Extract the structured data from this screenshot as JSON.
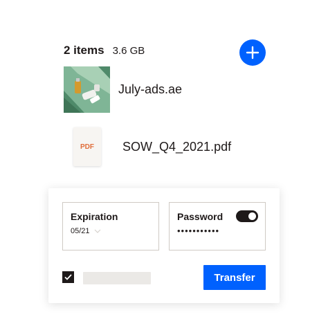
{
  "summary": {
    "count": "2 items",
    "size": "3.6 GB"
  },
  "colors": {
    "accent": "#0061fe",
    "dark": "#1e1919",
    "pdf_label": "#e06d3a"
  },
  "icons": {
    "add": "plus-icon",
    "check": "checkmark-icon",
    "chevron": "chevron-down-icon"
  },
  "files": [
    {
      "name": "July-ads.ae",
      "thumbnail": "image-thumbnail"
    },
    {
      "name": "SOW_Q4_2021.pdf",
      "thumbnail_label": "PDF"
    }
  ],
  "settings": {
    "expiration": {
      "label": "Expiration",
      "value": "05/21"
    },
    "password": {
      "label": "Password",
      "value": "•••••••••••",
      "enabled": true
    }
  },
  "actions": {
    "transfer_label": "Transfer",
    "option_checked": true
  }
}
